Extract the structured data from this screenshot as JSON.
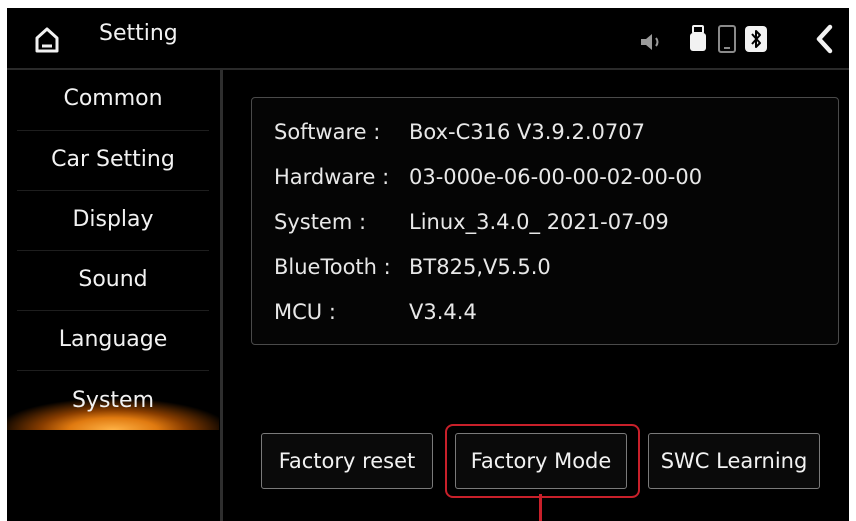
{
  "header": {
    "title": "Setting",
    "icons": [
      "home-icon",
      "volume-icon",
      "usb-icon",
      "phone-icon",
      "bluetooth-icon",
      "back-icon"
    ]
  },
  "sidebar": {
    "items": [
      {
        "label": "Common"
      },
      {
        "label": "Car Setting"
      },
      {
        "label": "Display"
      },
      {
        "label": "Sound"
      },
      {
        "label": "Language"
      },
      {
        "label": "System",
        "active": true
      }
    ]
  },
  "info": {
    "rows": [
      {
        "key": "Software :",
        "value": "Box-C316 V3.9.2.0707"
      },
      {
        "key": "Hardware :",
        "value": "03-000e-06-00-00-02-00-00"
      },
      {
        "key": "System :",
        "value": "Linux_3.4.0_ 2021-07-09"
      },
      {
        "key": "BlueTooth :",
        "value": "BT825,V5.5.0"
      },
      {
        "key": "MCU :",
        "value": "V3.4.4"
      }
    ]
  },
  "buttons": {
    "factory_reset": "Factory reset",
    "factory_mode": "Factory Mode",
    "swc_learning": "SWC Learning"
  },
  "colors": {
    "accent": "#e07a10",
    "highlight": "#c8202a"
  }
}
